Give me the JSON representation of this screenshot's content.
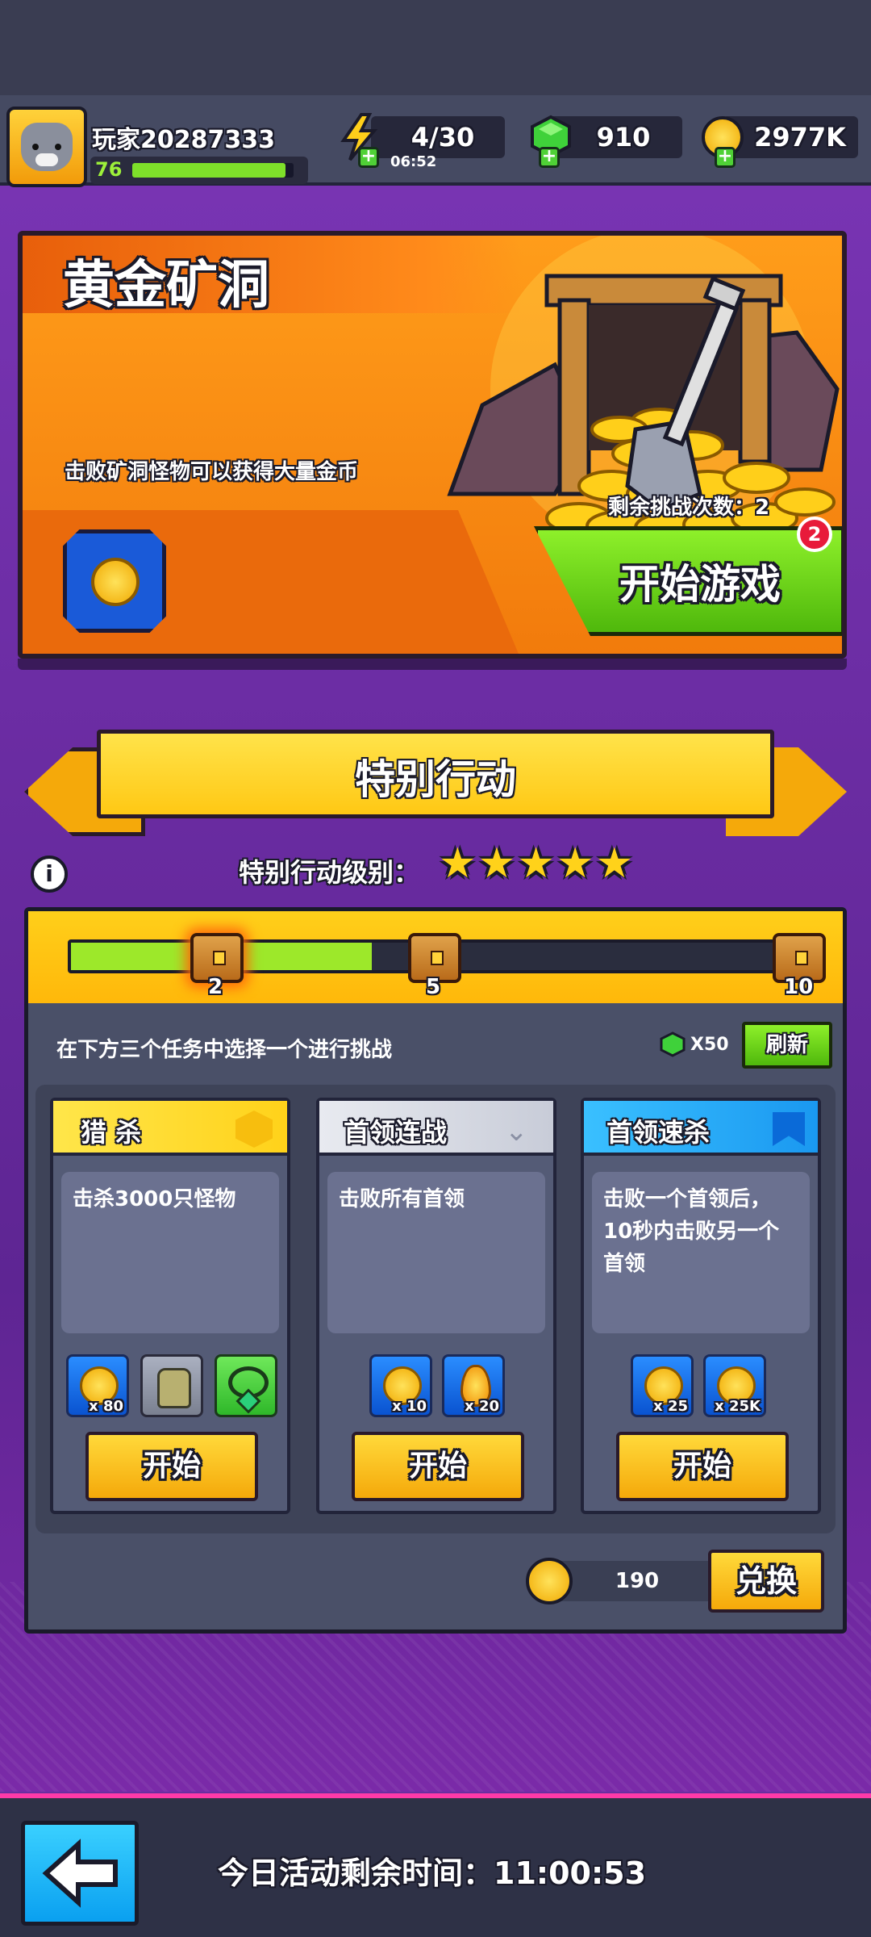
{
  "header": {
    "player_name": "玩家20287333",
    "level": "76",
    "level_progress": 0.95,
    "energy": "4/30",
    "energy_timer": "06:52",
    "gems": "910",
    "coins": "2977K"
  },
  "banner": {
    "title": "黄金矿洞",
    "description": "击败矿洞怪物可以获得大量金币",
    "remaining_label": "剩余挑战次数：2",
    "start_label": "开始游戏",
    "badge_count": "2"
  },
  "special": {
    "title": "特别行动",
    "level_label": "特别行动级别：",
    "stars": 5,
    "progress_fraction": 0.4,
    "milestones": [
      "2",
      "5",
      "10"
    ],
    "instruction": "在下方三个任务中选择一个进行挑战",
    "refresh_cost": "X50",
    "refresh_label": "刷新",
    "cards": [
      {
        "title": "猎 杀",
        "description": "击杀3000只怪物",
        "rewards": [
          {
            "icon": "coin-icon",
            "qty": "x 80"
          },
          {
            "icon": "glove-icon",
            "qty": ""
          },
          {
            "icon": "necklace-icon",
            "qty": ""
          }
        ],
        "start_label": "开始",
        "color": "#ffd21a"
      },
      {
        "title": "首领连战",
        "description": "击败所有首领",
        "rewards": [
          {
            "icon": "coin-icon",
            "qty": "x 10"
          },
          {
            "icon": "flame-icon",
            "qty": "x 20"
          }
        ],
        "start_label": "开始",
        "color": "#c8ccd8"
      },
      {
        "title": "首领速杀",
        "description": "击败一个首领后，10秒内击败另一个首领",
        "rewards": [
          {
            "icon": "coin-icon",
            "qty": "x 25"
          },
          {
            "icon": "gold-coin-icon",
            "qty": "x 25K"
          }
        ],
        "start_label": "开始",
        "color": "#21a8ff"
      }
    ],
    "token_count": "190",
    "exchange_label": "兑换"
  },
  "footer": {
    "remaining_time_label": "今日活动剩余时间：11:00:53"
  }
}
